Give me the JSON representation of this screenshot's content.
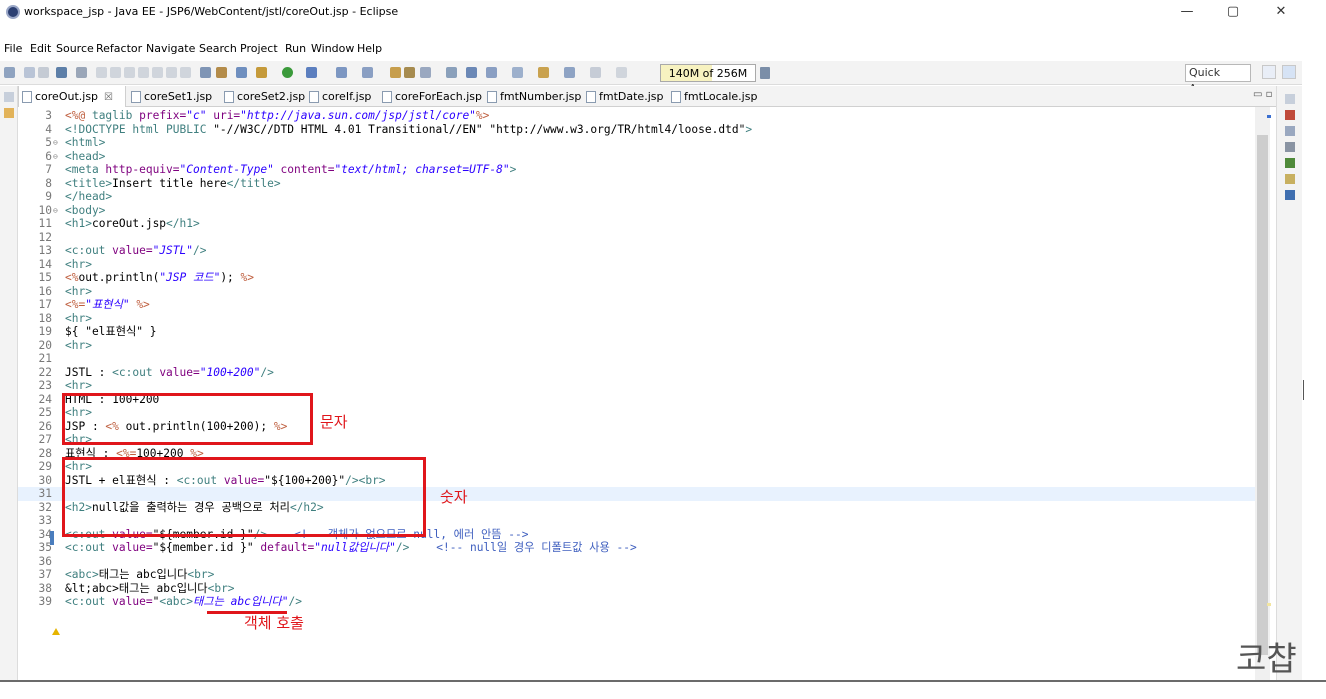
{
  "window": {
    "title": "workspace_jsp - Java EE - JSP6/WebContent/jstl/coreOut.jsp - Eclipse",
    "minimize": "—",
    "maximize": "▢",
    "close": "✕"
  },
  "menu": [
    "File",
    "Edit",
    "Source",
    "Refactor",
    "Navigate",
    "Search",
    "Project",
    "Run",
    "Window",
    "Help"
  ],
  "toolbar": {
    "heap_status": "140M of 256M",
    "heap_used_fraction": 0.547,
    "quick_access": "Quick Access"
  },
  "tabs": [
    {
      "label": "coreOut.jsp",
      "active": true,
      "close": "☒"
    },
    {
      "label": "coreSet1.jsp"
    },
    {
      "label": "coreSet2.jsp"
    },
    {
      "label": "coreIf.jsp"
    },
    {
      "label": "coreForEach.jsp"
    },
    {
      "label": "fmtNumber.jsp"
    },
    {
      "label": "fmtDate.jsp"
    },
    {
      "label": "fmtLocale.jsp"
    }
  ],
  "editor": {
    "current_line": "31",
    "lines": [
      {
        "n": "3",
        "segs": [
          [
            "<%@ ",
            "dir"
          ],
          [
            "taglib ",
            "tag"
          ],
          [
            "prefix=",
            "attr"
          ],
          [
            "\"c\"",
            "str"
          ],
          [
            " uri=",
            "attr"
          ],
          [
            "\"http://java.sun.com/jsp/jstl/core\"",
            "str"
          ],
          [
            "%>",
            "dir"
          ]
        ]
      },
      {
        "n": "4",
        "segs": [
          [
            "<!DOCTYPE html PUBLIC ",
            "tag"
          ],
          [
            "\"-//W3C//DTD HTML 4.01 Transitional//EN\"",
            "plain"
          ],
          [
            " ",
            "plain"
          ],
          [
            "\"http://www.w3.org/TR/html4/loose.dtd\"",
            "plain"
          ],
          [
            ">",
            "tag"
          ]
        ]
      },
      {
        "n": "5",
        "fold": "⊖",
        "segs": [
          [
            "<html>",
            "tag"
          ]
        ]
      },
      {
        "n": "6",
        "fold": "⊖",
        "segs": [
          [
            "<head>",
            "tag"
          ]
        ]
      },
      {
        "n": "7",
        "segs": [
          [
            "<meta ",
            "tag"
          ],
          [
            "http-equiv=",
            "attr"
          ],
          [
            "\"Content-Type\"",
            "str"
          ],
          [
            " content=",
            "attr"
          ],
          [
            "\"text/html; charset=UTF-8\"",
            "str"
          ],
          [
            ">",
            "tag"
          ]
        ]
      },
      {
        "n": "8",
        "segs": [
          [
            "<title>",
            "tag"
          ],
          [
            "Insert title here",
            "txt"
          ],
          [
            "</title>",
            "tag"
          ]
        ]
      },
      {
        "n": "9",
        "segs": [
          [
            "</head>",
            "tag"
          ]
        ]
      },
      {
        "n": "10",
        "fold": "⊖",
        "segs": [
          [
            "<body>",
            "tag"
          ]
        ]
      },
      {
        "n": "11",
        "segs": [
          [
            "<h1>",
            "tag"
          ],
          [
            "coreOut.jsp",
            "txt"
          ],
          [
            "</h1>",
            "tag"
          ]
        ]
      },
      {
        "n": "12",
        "segs": []
      },
      {
        "n": "13",
        "segs": [
          [
            "<c:out ",
            "tag"
          ],
          [
            "value=",
            "attr"
          ],
          [
            "\"JSTL\"",
            "str"
          ],
          [
            "/>",
            "tag"
          ]
        ]
      },
      {
        "n": "14",
        "segs": [
          [
            "<hr>",
            "tag"
          ]
        ]
      },
      {
        "n": "15",
        "segs": [
          [
            "<%",
            "dir"
          ],
          [
            "out.println(",
            "txt"
          ],
          [
            "\"JSP 코드\"",
            "str"
          ],
          [
            ");",
            "txt"
          ],
          [
            " %>",
            "dir"
          ]
        ]
      },
      {
        "n": "16",
        "segs": [
          [
            "<hr>",
            "tag"
          ]
        ]
      },
      {
        "n": "17",
        "segs": [
          [
            "<%=",
            "dir"
          ],
          [
            "\"표현식\"",
            "str"
          ],
          [
            " %>",
            "dir"
          ]
        ]
      },
      {
        "n": "18",
        "segs": [
          [
            "<hr>",
            "tag"
          ]
        ]
      },
      {
        "n": "19",
        "segs": [
          [
            "${ \"el표현식\" }",
            "txt"
          ]
        ]
      },
      {
        "n": "20",
        "segs": [
          [
            "<hr>",
            "tag"
          ]
        ]
      },
      {
        "n": "21",
        "segs": []
      },
      {
        "n": "22",
        "segs": [
          [
            "JSTL : ",
            "txt"
          ],
          [
            "<c:out ",
            "tag"
          ],
          [
            "value=",
            "attr"
          ],
          [
            "\"100+200\"",
            "str"
          ],
          [
            "/>",
            "tag"
          ]
        ]
      },
      {
        "n": "23",
        "segs": [
          [
            "<hr>",
            "tag"
          ]
        ]
      },
      {
        "n": "24",
        "segs": [
          [
            "HTML : 100+200",
            "txt"
          ]
        ]
      },
      {
        "n": "25",
        "segs": [
          [
            "<hr>",
            "tag"
          ]
        ]
      },
      {
        "n": "26",
        "segs": [
          [
            "JSP : ",
            "txt"
          ],
          [
            "<%",
            "dir"
          ],
          [
            " out.println(100+200); ",
            "txt"
          ],
          [
            "%>",
            "dir"
          ]
        ]
      },
      {
        "n": "27",
        "segs": [
          [
            "<hr>",
            "tag"
          ]
        ]
      },
      {
        "n": "28",
        "segs": [
          [
            "표현식 : ",
            "txt"
          ],
          [
            "<%=",
            "dir"
          ],
          [
            "100+200 ",
            "txt"
          ],
          [
            "%>",
            "dir"
          ]
        ]
      },
      {
        "n": "29",
        "segs": [
          [
            "<hr>",
            "tag"
          ]
        ]
      },
      {
        "n": "30",
        "segs": [
          [
            "JSTL + el표현식 : ",
            "txt"
          ],
          [
            "<c:out ",
            "tag"
          ],
          [
            "value=",
            "attr"
          ],
          [
            "\"${100+200}\"",
            "plain"
          ],
          [
            "/>",
            "tag"
          ],
          [
            "<br>",
            "tag"
          ]
        ]
      },
      {
        "n": "31",
        "segs": []
      },
      {
        "n": "32",
        "segs": [
          [
            "<h2>",
            "tag"
          ],
          [
            "null값을 출력하는 경우 공백으로 처리",
            "txt"
          ],
          [
            "</h2>",
            "tag"
          ]
        ]
      },
      {
        "n": "33",
        "segs": []
      },
      {
        "n": "34",
        "segs": [
          [
            "<c:out ",
            "tag"
          ],
          [
            "value=",
            "attr"
          ],
          [
            "\"${member.id }\"",
            "plain"
          ],
          [
            "/>",
            "tag"
          ],
          [
            "    ",
            "plain"
          ],
          [
            "<!-- 객체가 없으므로 null, 에러 안뜸 -->",
            "comment"
          ]
        ]
      },
      {
        "n": "35",
        "segs": [
          [
            "<c:out ",
            "tag"
          ],
          [
            "value=",
            "attr"
          ],
          [
            "\"${member.id }\"",
            "plain"
          ],
          [
            " default=",
            "attr"
          ],
          [
            "\"null값입니다\"",
            "str"
          ],
          [
            "/>",
            "tag"
          ],
          [
            "    ",
            "plain"
          ],
          [
            "<!-- null일 경우 디폴트값 사용 -->",
            "comment"
          ]
        ]
      },
      {
        "n": "36",
        "segs": []
      },
      {
        "n": "37",
        "segs": [
          [
            "<abc>",
            "tag"
          ],
          [
            "태그는 abc입니다",
            "txt"
          ],
          [
            "<br>",
            "tag"
          ]
        ]
      },
      {
        "n": "38",
        "segs": [
          [
            "&lt;abc>태그는 abc입니다",
            "txt"
          ],
          [
            "<br>",
            "tag"
          ]
        ]
      },
      {
        "n": "39",
        "segs": [
          [
            "<c:out ",
            "tag"
          ],
          [
            "value=",
            "attr"
          ],
          [
            "\"",
            "plain"
          ],
          [
            "<abc>",
            "tag"
          ],
          [
            "태그는 abc입니다\"",
            "str"
          ],
          [
            "/>",
            "tag"
          ]
        ]
      }
    ]
  },
  "annotations": {
    "char_label": "문자",
    "number_label": "숫자",
    "object_call_label": "객체 호출"
  },
  "watermark": "코챱"
}
